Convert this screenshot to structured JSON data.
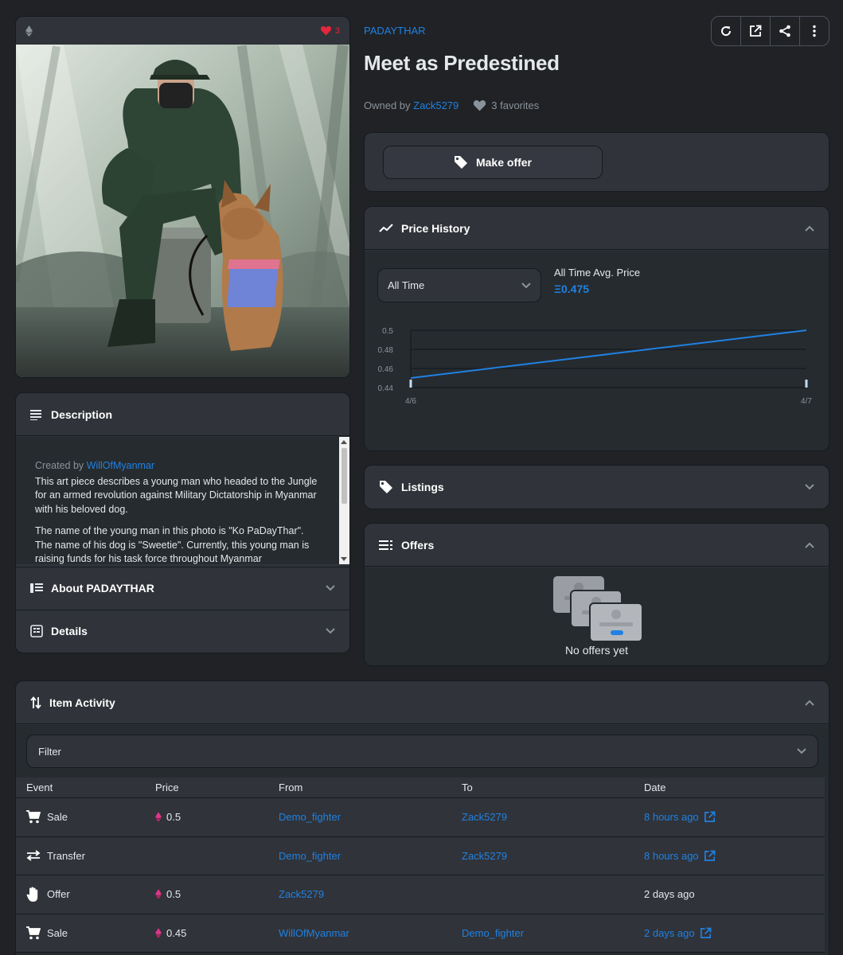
{
  "media": {
    "favorite_count": "3"
  },
  "header": {
    "collection": "PADAYTHAR",
    "title": "Meet as Predestined",
    "owned_by_label": "Owned by",
    "owner": "Zack5279",
    "favorites_label": "3 favorites"
  },
  "actions": [
    "refresh-icon",
    "external-link-icon",
    "share-icon",
    "more-icon"
  ],
  "offer_panel": {
    "make_offer_label": "Make offer"
  },
  "description": {
    "heading": "Description",
    "created_by_label": "Created by",
    "creator": "WillOfMyanmar",
    "paragraph_1": "This art piece describes a young man who headed to the Jungle for an armed revolution against Military Dictatorship in Myanmar with his beloved dog.",
    "paragraph_2": "The name of the young man in this photo is \"Ko PaDayThar\". The name of his dog is \"Sweetie\". Currently, this young man is raising funds for his task force throughout Myanmar",
    "about_label": "About PADAYTHAR",
    "details_label": "Details"
  },
  "price_history": {
    "heading": "Price History",
    "period": "All Time",
    "avg_label": "All Time Avg. Price",
    "avg_value": "Ξ0.475"
  },
  "chart_data": {
    "type": "line",
    "x": [
      "4/6",
      "4/7"
    ],
    "series": [
      {
        "values": [
          0.45,
          0.5
        ]
      }
    ],
    "y_ticks": [
      "0.44",
      "0.46",
      "0.48",
      "0.5"
    ],
    "ylim": [
      0.44,
      0.5
    ],
    "grid": true,
    "color": "#2081e2"
  },
  "listings": {
    "heading": "Listings"
  },
  "offers": {
    "heading": "Offers",
    "empty_text": "No offers yet"
  },
  "activity": {
    "heading": "Item Activity",
    "filter_label": "Filter",
    "columns": [
      "Event",
      "Price",
      "From",
      "To",
      "Date"
    ],
    "rows": [
      {
        "event": "Sale",
        "icon": "cart-icon",
        "price": "0.5",
        "from": "Demo_fighter",
        "to": "Zack5279",
        "date": "8 hours ago",
        "date_link": true
      },
      {
        "event": "Transfer",
        "icon": "transfer-icon",
        "price": "",
        "from": "Demo_fighter",
        "to": "Zack5279",
        "date": "8 hours ago",
        "date_link": true
      },
      {
        "event": "Offer",
        "icon": "hand-icon",
        "price": "0.5",
        "from": "Zack5279",
        "to": "",
        "date": "2 days ago",
        "date_link": false
      },
      {
        "event": "Sale",
        "icon": "cart-icon",
        "price": "0.45",
        "from": "WillOfMyanmar",
        "to": "Demo_fighter",
        "date": "2 days ago",
        "date_link": true
      }
    ]
  },
  "colors": {
    "background": "#202225",
    "panel": "#303339",
    "accent": "#2081e2",
    "favorite": "#e2263e"
  }
}
